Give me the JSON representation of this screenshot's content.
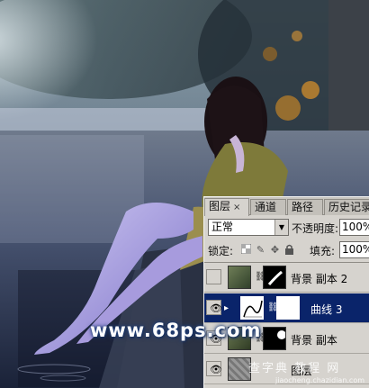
{
  "layers_panel": {
    "tabs": [
      {
        "label": "图层",
        "close": "×"
      },
      {
        "label": "通道"
      },
      {
        "label": "路径"
      },
      {
        "label": "历史记录"
      }
    ],
    "blend_mode": "正常",
    "opacity_label": "不透明度:",
    "opacity_value": "100%",
    "lock_label": "锁定:",
    "fill_label": "填充:",
    "fill_value": "100%",
    "layers": [
      {
        "name": "背景 副本 2",
        "visible": false,
        "selected": false
      },
      {
        "name": "曲线 3",
        "visible": true,
        "selected": true
      },
      {
        "name": "背景 副本",
        "visible": true,
        "selected": false
      },
      {
        "name": "图层",
        "visible": true,
        "selected": false
      }
    ]
  },
  "icons": {
    "eye": "eye-icon",
    "link": "chain-link-icon",
    "lock_transparent": "checker-lock-icon",
    "lock_brush": "brush-lock-icon",
    "lock_move": "move-lock-icon",
    "lock_all": "padlock-icon"
  },
  "watermarks": {
    "url": "www.68ps.com",
    "site_cn": "查字典 教程 网",
    "site_en": "jiaocheng.chazidian.com"
  },
  "colors": {
    "selected_layer": "#0a246a",
    "panel_bg": "#d6d3ce"
  }
}
